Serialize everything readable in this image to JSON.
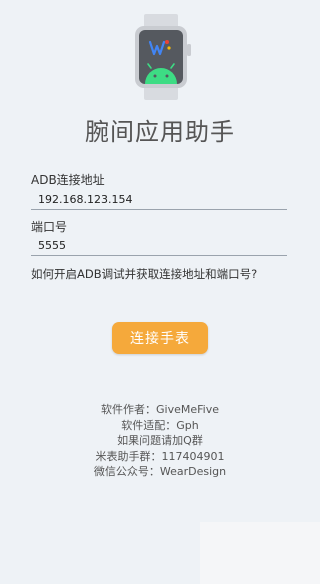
{
  "app": {
    "title": "腕间应用助手"
  },
  "form": {
    "address_label": "ADB连接地址",
    "address_value": "192.168.123.154",
    "port_label": "端口号",
    "port_value": "5555",
    "help_text": "如何开启ADB调试并获取连接地址和端口号?"
  },
  "actions": {
    "connect_label": "连接手表"
  },
  "credits": [
    "软件作者：GiveMeFive",
    "软件适配：Gph",
    "如果问题请加Q群",
    "米表助手群：117404901",
    "微信公众号：WearDesign"
  ],
  "colors": {
    "accent": "#f5a93b",
    "background": "#eef2f6",
    "android_green": "#3ddc84"
  },
  "icons": {
    "logo": "smartwatch-android-icon"
  }
}
